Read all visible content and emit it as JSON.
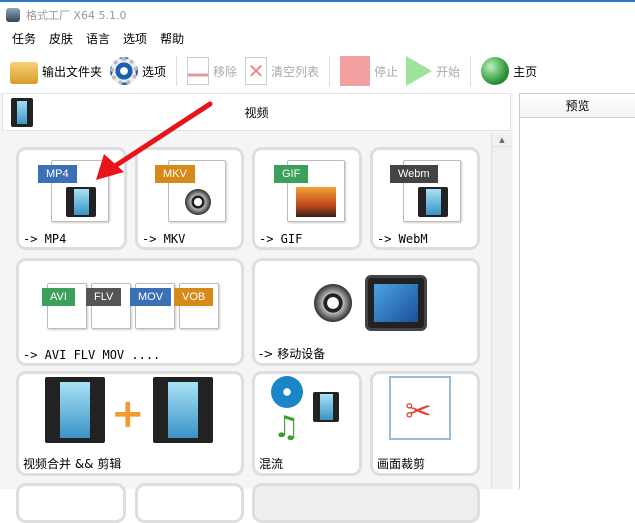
{
  "window": {
    "title": "格式工厂 X64 5.1.0"
  },
  "menu": [
    "任务",
    "皮肤",
    "语言",
    "选项",
    "帮助"
  ],
  "toolbar": {
    "output_folder": "输出文件夹",
    "options": "选项",
    "remove": "移除",
    "clear_list": "清空列表",
    "stop": "停止",
    "start": "开始",
    "home": "主页"
  },
  "section": {
    "title": "视频"
  },
  "preview": {
    "title": "预览"
  },
  "tiles": [
    {
      "badge": "MP4",
      "label": "-> MP4",
      "color": "#3b6fb6"
    },
    {
      "badge": "MKV",
      "label": "-> MKV",
      "color": "#d68a1a"
    },
    {
      "badge": "GIF",
      "label": "-> GIF",
      "color": "#3aa05a"
    },
    {
      "badge": "Webm",
      "label": "-> WebM",
      "color": "#444444"
    },
    {
      "badges": [
        "AVI",
        "FLV",
        "MOV",
        "VOB"
      ],
      "label": "-> AVI FLV MOV ...."
    },
    {
      "label": "-> 移动设备"
    },
    {
      "label": "视频合并 && 剪辑"
    },
    {
      "label": "混流"
    },
    {
      "label": "画面裁剪"
    }
  ]
}
